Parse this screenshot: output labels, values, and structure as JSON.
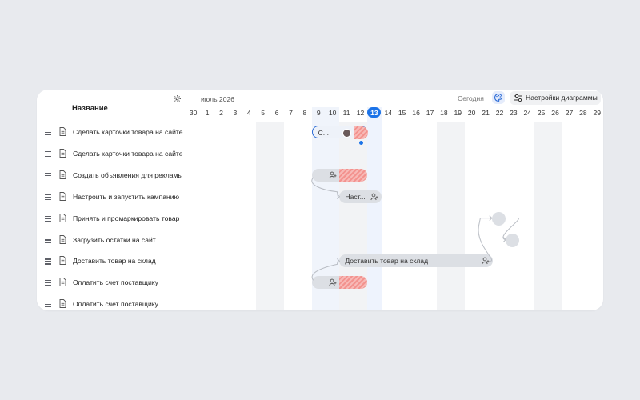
{
  "left": {
    "column_title": "Название",
    "tasks": [
      {
        "name": "Сделать карточки товара на сайте"
      },
      {
        "name": "Сделать карточки товара на сайте"
      },
      {
        "name": "Создать объявления для рекламы"
      },
      {
        "name": "Настроить и запустить кампанию"
      },
      {
        "name": "Принять и промаркировать товар"
      },
      {
        "name": "Загрузить остатки на сайт"
      },
      {
        "name": "Доставить товар на склад"
      },
      {
        "name": "Оплатить счет поставщику"
      },
      {
        "name": "Оплатить счет поставщику"
      }
    ]
  },
  "toolbar": {
    "month": "июль 2026",
    "today": "Сегодня",
    "settings": "Настройки диаграммы"
  },
  "days": [
    "30",
    "1",
    "2",
    "3",
    "4",
    "5",
    "6",
    "7",
    "8",
    "9",
    "10",
    "11",
    "12",
    "13",
    "14",
    "15",
    "16",
    "17",
    "18",
    "19",
    "20",
    "21",
    "22",
    "23",
    "24",
    "25",
    "26",
    "27",
    "28",
    "29"
  ],
  "today_day": "13",
  "bars": [
    {
      "row": 0,
      "start": 9,
      "end": 13,
      "hatch_start": 12,
      "label": "С...",
      "selected": true,
      "icon": "avatar"
    },
    {
      "row": 2,
      "start": 9,
      "end": 13,
      "hatch_start": 11,
      "label": "",
      "icon": "add-user-icon"
    },
    {
      "row": 3,
      "start": 11,
      "end": 14,
      "label": "Наст...",
      "icon": "add-user-icon"
    },
    {
      "row": 6,
      "start": 11,
      "end": 22,
      "label": "Доставить товар на склад",
      "icon": "add-user-icon"
    },
    {
      "row": 7,
      "start": 9,
      "end": 13,
      "hatch_start": 11,
      "label": "",
      "icon": "add-user-icon"
    }
  ],
  "milestones": [
    {
      "row": 4,
      "day": 22
    },
    {
      "row": 5,
      "day": 23
    }
  ],
  "colors": {
    "accent": "#1b73e8",
    "bar": "#dcdfe4",
    "hatch": "#f3928e",
    "weekend": "#f2f3f5"
  }
}
